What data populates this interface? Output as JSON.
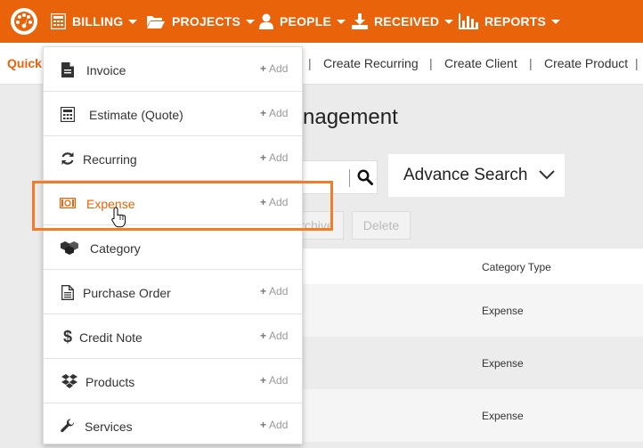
{
  "nav": {
    "items": [
      {
        "label": "BILLING",
        "icon": "calculator-icon"
      },
      {
        "label": "PROJECTS",
        "icon": "folder-icon"
      },
      {
        "label": "PEOPLE",
        "icon": "person-icon"
      },
      {
        "label": "RECEIVED",
        "icon": "download-icon"
      },
      {
        "label": "REPORTS",
        "icon": "bar-chart-icon"
      }
    ]
  },
  "quickbar": {
    "label": "Quick",
    "links": [
      "Create Recurring",
      "Create Client",
      "Create Product"
    ]
  },
  "page": {
    "title": "nagement",
    "advance_search": "Advance Search",
    "archive_label": "Archive",
    "delete_label": "Delete"
  },
  "table": {
    "header": "Category Type",
    "rows": [
      "Expense",
      "Expense",
      "Expense"
    ]
  },
  "dropdown": {
    "add_label": "Add",
    "items": [
      {
        "label": "Invoice",
        "icon": "document-icon",
        "add": true
      },
      {
        "label": "Estimate (Quote)",
        "icon": "calculator-icon",
        "add": true
      },
      {
        "label": "Recurring",
        "icon": "refresh-icon",
        "add": true
      },
      {
        "label": "Expense",
        "icon": "money-icon",
        "add": true,
        "active": true
      },
      {
        "label": "Category",
        "icon": "cubes-icon",
        "add": false
      },
      {
        "label": "Purchase Order",
        "icon": "file-text-icon",
        "add": true
      },
      {
        "label": "Credit Note",
        "icon": "dollar-icon",
        "add": true
      },
      {
        "label": "Products",
        "icon": "dropbox-icon",
        "add": true
      },
      {
        "label": "Services",
        "icon": "wrench-icon",
        "add": true
      }
    ]
  },
  "colors": {
    "accent": "#e8630a",
    "highlight": "#ef7d2b"
  }
}
